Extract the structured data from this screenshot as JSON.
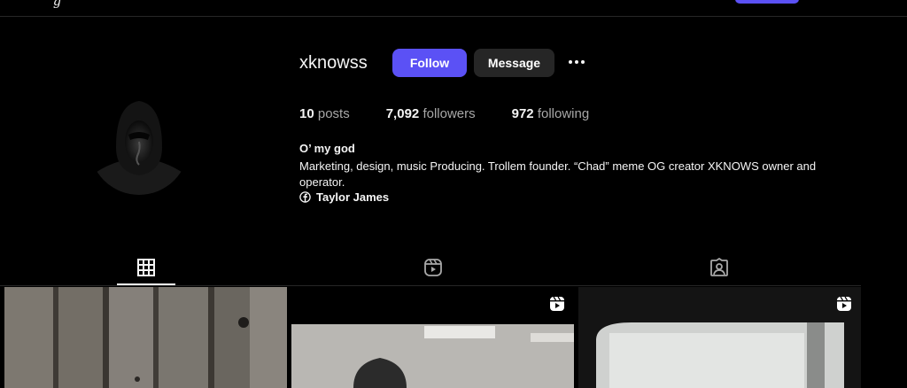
{
  "top": {
    "logo_fragment": "g"
  },
  "profile": {
    "username": "xknowss",
    "follow_label": "Follow",
    "message_label": "Message",
    "stats": {
      "posts_count": "10",
      "posts_label": "posts",
      "followers_count": "7,092",
      "followers_label": "followers",
      "following_count": "972",
      "following_label": "following"
    },
    "bio": {
      "name": "O’ my god",
      "text": "Marketing, design, music Producing. Trollem founder. “Chad” meme OG creator XKNOWS owner and operator.",
      "link_label": "Taylor James",
      "link_icon": "facebook-icon"
    }
  },
  "tabs": [
    {
      "icon": "grid-icon",
      "active": true
    },
    {
      "icon": "reels-icon",
      "active": false
    },
    {
      "icon": "tagged-icon",
      "active": false
    }
  ],
  "grid": [
    {
      "type": "image",
      "has_reel_badge": false
    },
    {
      "type": "reel",
      "has_reel_badge": true
    },
    {
      "type": "reel",
      "has_reel_badge": true
    }
  ],
  "colors": {
    "accent": "#5b51f5",
    "background": "#000000",
    "secondary_button": "#262626",
    "muted_text": "#a8a8a8"
  }
}
